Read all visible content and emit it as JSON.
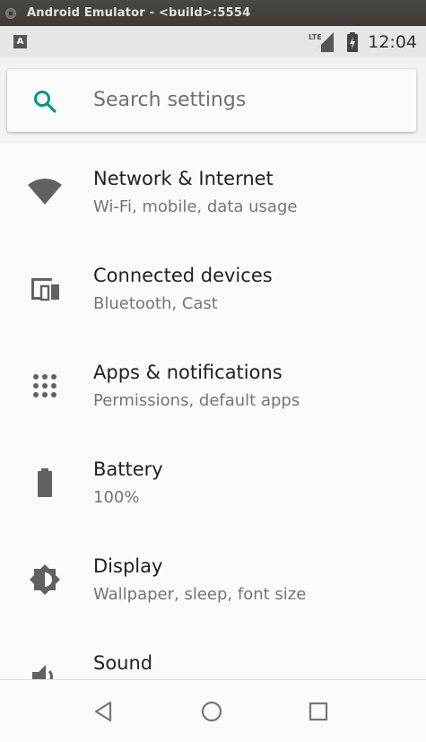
{
  "window": {
    "title": "Android Emulator - <build>:5554"
  },
  "status_bar": {
    "notification_icon": "A",
    "network_label": "LTE",
    "time": "12:04"
  },
  "search": {
    "placeholder": "Search settings",
    "icon": "search-icon"
  },
  "accent_color": "#009688",
  "settings": [
    {
      "title": "Network & Internet",
      "subtitle": "Wi-Fi, mobile, data usage",
      "icon": "wifi-icon"
    },
    {
      "title": "Connected devices",
      "subtitle": "Bluetooth, Cast",
      "icon": "devices-icon"
    },
    {
      "title": "Apps & notifications",
      "subtitle": "Permissions, default apps",
      "icon": "apps-icon"
    },
    {
      "title": "Battery",
      "subtitle": "100%",
      "icon": "battery-icon"
    },
    {
      "title": "Display",
      "subtitle": "Wallpaper, sleep, font size",
      "icon": "brightness-icon"
    },
    {
      "title": "Sound",
      "subtitle": "",
      "icon": "volume-icon"
    }
  ],
  "nav_bar": {
    "back": "back-icon",
    "home": "home-icon",
    "recents": "recents-icon"
  }
}
